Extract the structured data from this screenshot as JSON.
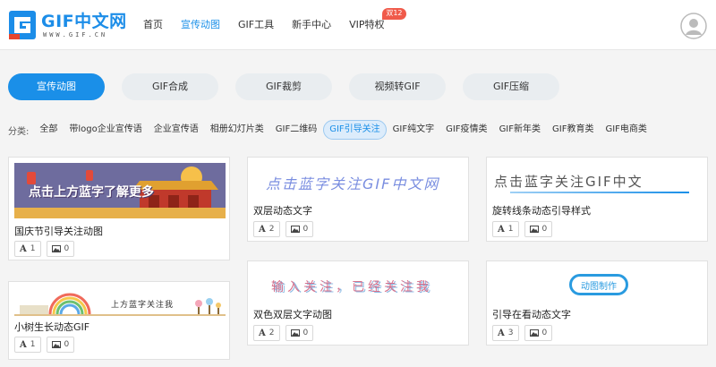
{
  "header": {
    "logo_text": "GIF中文网",
    "logo_sub": "WWW.GIF.CN",
    "nav": [
      {
        "label": "首页"
      },
      {
        "label": "宣传动图"
      },
      {
        "label": "GIF工具"
      },
      {
        "label": "新手中心"
      },
      {
        "label": "VIP特权",
        "badge": "双12"
      }
    ],
    "active_nav": 1
  },
  "categories": {
    "items": [
      "宣传动图",
      "GIF合成",
      "GIF裁剪",
      "视频转GIF",
      "GIF压缩"
    ],
    "active": 0
  },
  "filters": {
    "label": "分类:",
    "items": [
      "全部",
      "带logo企业宣传语",
      "企业宣传语",
      "相册幻灯片类",
      "GIF二维码",
      "GIF引导关注",
      "GIF纯文字",
      "GIF疫情类",
      "GIF新年类",
      "GIF教育类",
      "GIF电商类"
    ],
    "active": 5
  },
  "cards": [
    {
      "title": "国庆节引导关注动图",
      "text_count": "1",
      "image_count": "0",
      "thumb_text": "点击上方蓝字了解更多"
    },
    {
      "title": "双层动态文字",
      "text_count": "2",
      "image_count": "0",
      "thumb_text": "点击蓝字关注GIF中文网"
    },
    {
      "title": "旋转线条动态引导样式",
      "text_count": "1",
      "image_count": "0",
      "thumb_text": "点击蓝字关注GIF中文"
    },
    {
      "title": "小树生长动态GIF",
      "text_count": "1",
      "image_count": "0",
      "thumb_text": "上方蓝字关注我"
    },
    {
      "title": "双色双层文字动图",
      "text_count": "2",
      "image_count": "0",
      "thumb_text": "输入关注，已经关注我"
    },
    {
      "title": "引导在看动态文字",
      "text_count": "3",
      "image_count": "0",
      "thumb_text": "动图制作"
    }
  ],
  "colors": {
    "accent": "#1a8fe8",
    "badge": "#f05a4a"
  }
}
